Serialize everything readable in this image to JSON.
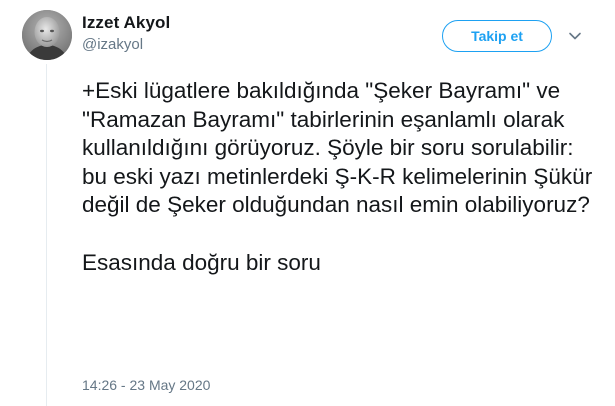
{
  "tweet": {
    "author": {
      "display_name": "Izzet Akyol",
      "handle": "@izakyol"
    },
    "follow_button_label": "Takip et",
    "menu_icon": "chevron-down-icon",
    "body": {
      "paragraph_1": "+Eski lügatlere bakıldığında \"Şeker Bayramı\" ve \"Ramazan Bayramı\" tabirlerinin eşanlamlı olarak kullanıldığını görüyoruz. Şöyle bir soru sorulabilir: bu eski yazı metinlerdeki Ş-K-R kelimelerinin Şükür değil de Şeker olduğundan nasıl emin olabiliyoruz?",
      "paragraph_2": "Esasında doğru bir soru"
    },
    "timestamp": "14:26 - 23 May 2020"
  },
  "colors": {
    "accent": "#1da1f2",
    "text": "#14171a",
    "secondary_text": "#657786"
  }
}
